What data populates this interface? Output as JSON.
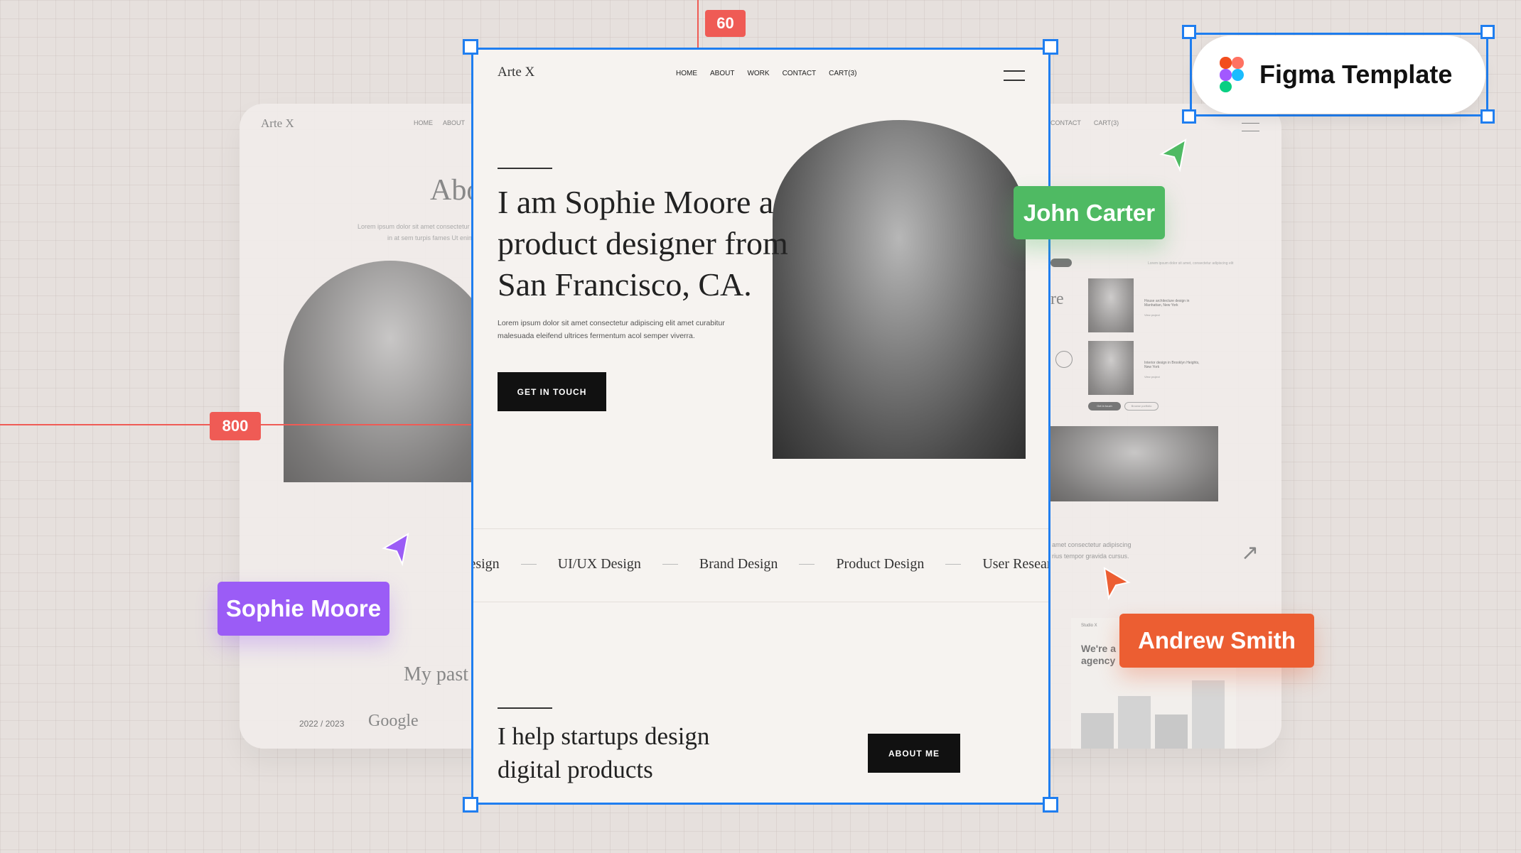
{
  "rulers": {
    "top": "60",
    "left": "800"
  },
  "badge": {
    "label": "Figma Template",
    "icon": "figma-logo"
  },
  "cursors": [
    {
      "name": "Sophie Moore",
      "color": "#9b5cf6"
    },
    {
      "name": "John Carter",
      "color": "#4fba63"
    },
    {
      "name": "Andrew Smith",
      "color": "#ec5e32"
    }
  ],
  "colors": {
    "selection": "#1f7ef0",
    "ruler": "#ef5b55"
  },
  "left_card": {
    "logo": "Arte X",
    "nav": [
      "HOME",
      "ABOUT"
    ],
    "heading": "Abo",
    "lorem1": "Lorem ipsum dolor sit amet consectetur",
    "lorem2": "in at sem turpis fames Ut enim",
    "past": "My past",
    "year": "2022 / 2023",
    "company": "Google"
  },
  "right_card": {
    "nav": [
      "CONTACT",
      "CART(3)"
    ],
    "heading_frag": "re",
    "desc": "Lorem ipsum dolor sit amet, consectetur adipiscing elit",
    "projects": [
      {
        "title": "House architecture design in Manhattan, New York",
        "link": "View project"
      },
      {
        "title": "Interior design in Brooklyn Heights, New York",
        "link": "View project"
      }
    ],
    "btn1": "Get in touch",
    "btn2": "Browse portfolio",
    "text1": "amet consectetur adipiscing",
    "text2": "rius tempor gravida cursus.",
    "studio": "Studio X",
    "agency1": "We're a",
    "agency2": "agency"
  },
  "main": {
    "logo": "Arte X",
    "nav": [
      "HOME",
      "ABOUT",
      "WORK",
      "CONTACT",
      "CART(3)"
    ],
    "headline": [
      "I am Sophie Moore a",
      "product designer from",
      "San Francisco, CA."
    ],
    "paragraph": [
      "Lorem ipsum dolor sit amet consectetur adipiscing elit amet curabitur",
      "malesuada eleifend ultrices fermentum acol semper viverra."
    ],
    "cta": "GET IN TOUCH",
    "services": [
      "Design",
      "UI/UX Design",
      "Brand Design",
      "Product Design",
      "User Research"
    ],
    "subheadline": [
      "I help startups design",
      "digital products"
    ],
    "about_btn": "ABOUT ME"
  }
}
